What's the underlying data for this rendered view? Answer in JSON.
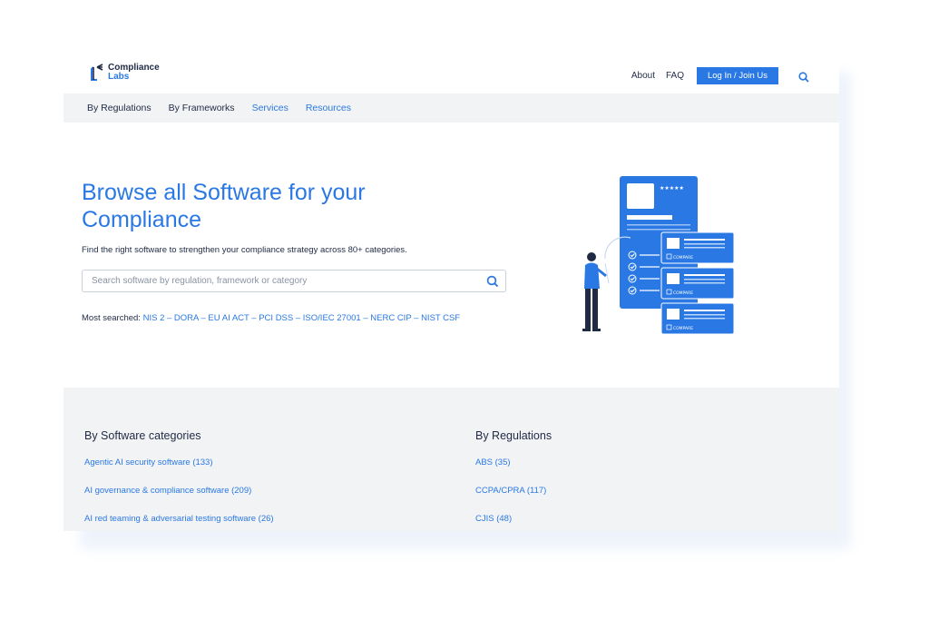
{
  "brand": {
    "line1": "Compliance",
    "line2": "Labs"
  },
  "topnav": {
    "about": "About",
    "faq": "FAQ",
    "login": "Log In / Join Us"
  },
  "subnav": [
    "By Regulations",
    "By Frameworks",
    "Services",
    "Resources"
  ],
  "hero": {
    "title": "Browse all Software for your Compliance",
    "subtitle": "Find the right software to strengthen your compliance strategy across 80+ categories.",
    "search_placeholder": "Search software by regulation, framework or category",
    "most_searched_label": "Most searched:",
    "most_searched": [
      "NIS 2",
      "DORA",
      "EU AI ACT",
      "PCI DSS",
      "ISO/IEC 27001",
      "NERC CIP",
      "NIST CSF"
    ]
  },
  "illustration": {
    "compare_label": "COMPARE",
    "stars": "★★★★★"
  },
  "categories": {
    "heading": "By Software categories",
    "items": [
      "Agentic AI security software (133)",
      "AI governance & compliance software (209)",
      "AI red teaming & adversarial testing software (26)"
    ]
  },
  "regulations": {
    "heading": "By Regulations",
    "items": [
      "ABS (35)",
      "CCPA/CPRA (117)",
      "CJIS (48)"
    ]
  },
  "colors": {
    "accent": "#2a78e4",
    "text": "#1f2a44",
    "panel": "#f2f3f5"
  }
}
